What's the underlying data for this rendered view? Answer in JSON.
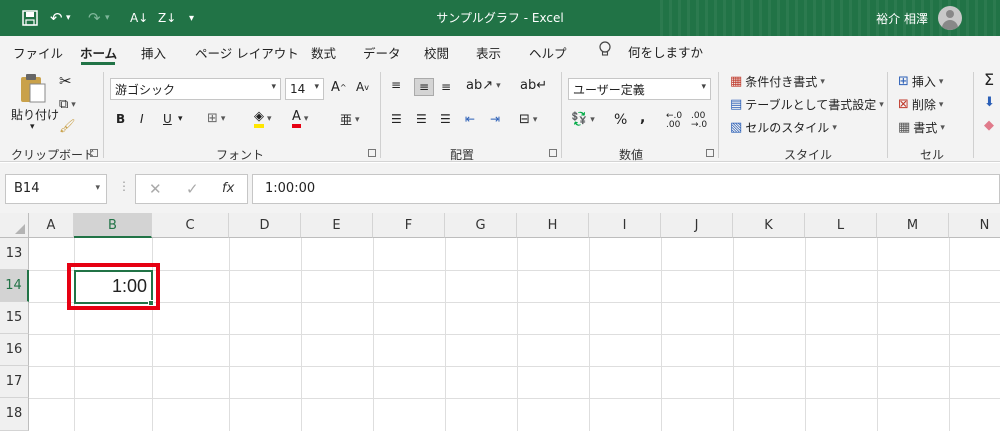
{
  "window": {
    "title": "サンプルグラフ  -  Excel",
    "user": "裕介 相澤"
  },
  "menu": {
    "tabs": [
      "ファイル",
      "ホーム",
      "挿入",
      "ページ レイアウト",
      "数式",
      "データ",
      "校閲",
      "表示",
      "ヘルプ"
    ],
    "tellme": "何をしますか"
  },
  "ribbon": {
    "clipboard": {
      "paste": "貼り付け",
      "label": "クリップボード"
    },
    "font": {
      "name": "游ゴシック",
      "size": "14",
      "label": "フォント",
      "bold": "B",
      "italic": "I",
      "underline": "U"
    },
    "alignment": {
      "label": "配置"
    },
    "number": {
      "format": "ユーザー定義",
      "label": "数値",
      "percent": "%",
      "comma": ","
    },
    "styles": {
      "conditional": "条件付き書式",
      "table": "テーブルとして書式設定",
      "cell": "セルのスタイル",
      "label": "スタイル"
    },
    "cells": {
      "insert": "挿入",
      "delete": "削除",
      "format": "書式",
      "label": "セル"
    }
  },
  "formula_bar": {
    "name_box": "B14",
    "fx": "fx",
    "value": "1:00:00"
  },
  "sheet": {
    "columns": [
      "A",
      "B",
      "C",
      "D",
      "E",
      "F",
      "G",
      "H",
      "I",
      "J",
      "K",
      "L",
      "M",
      "N"
    ],
    "rows": [
      "13",
      "14",
      "15",
      "16",
      "17",
      "18"
    ],
    "active_cell": {
      "ref": "B14",
      "display": "1:00"
    }
  },
  "colors": {
    "accent": "#217346",
    "highlight": "#e60012"
  }
}
